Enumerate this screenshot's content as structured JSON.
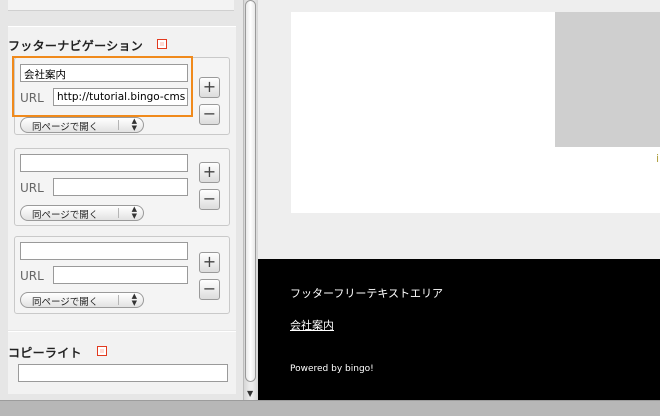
{
  "sidebar": {
    "footer_nav": {
      "title": "フッターナビゲーション",
      "items": [
        {
          "title_value": "会社案内",
          "url_label": "URL",
          "url_value": "http://tutorial.bingo-cms",
          "target": "同ページで開く",
          "add": "+",
          "remove": "−"
        },
        {
          "title_value": "",
          "url_label": "URL",
          "url_value": "",
          "target": "同ページで開く",
          "add": "+",
          "remove": "−"
        },
        {
          "title_value": "",
          "url_label": "URL",
          "url_value": "",
          "target": "同ページで開く",
          "add": "+",
          "remove": "−"
        }
      ]
    },
    "copyright": {
      "title": "コピーライト",
      "value": ""
    }
  },
  "preview": {
    "footer_free_text": "フッターフリーテキストエリア",
    "footer_link": "会社案内",
    "powered_by": "Powered by bingo!",
    "side_glyph": "i"
  },
  "colors": {
    "focus_outline": "#f08a1c",
    "help_icon": "#e23a1f",
    "footer_bg": "#000000"
  }
}
